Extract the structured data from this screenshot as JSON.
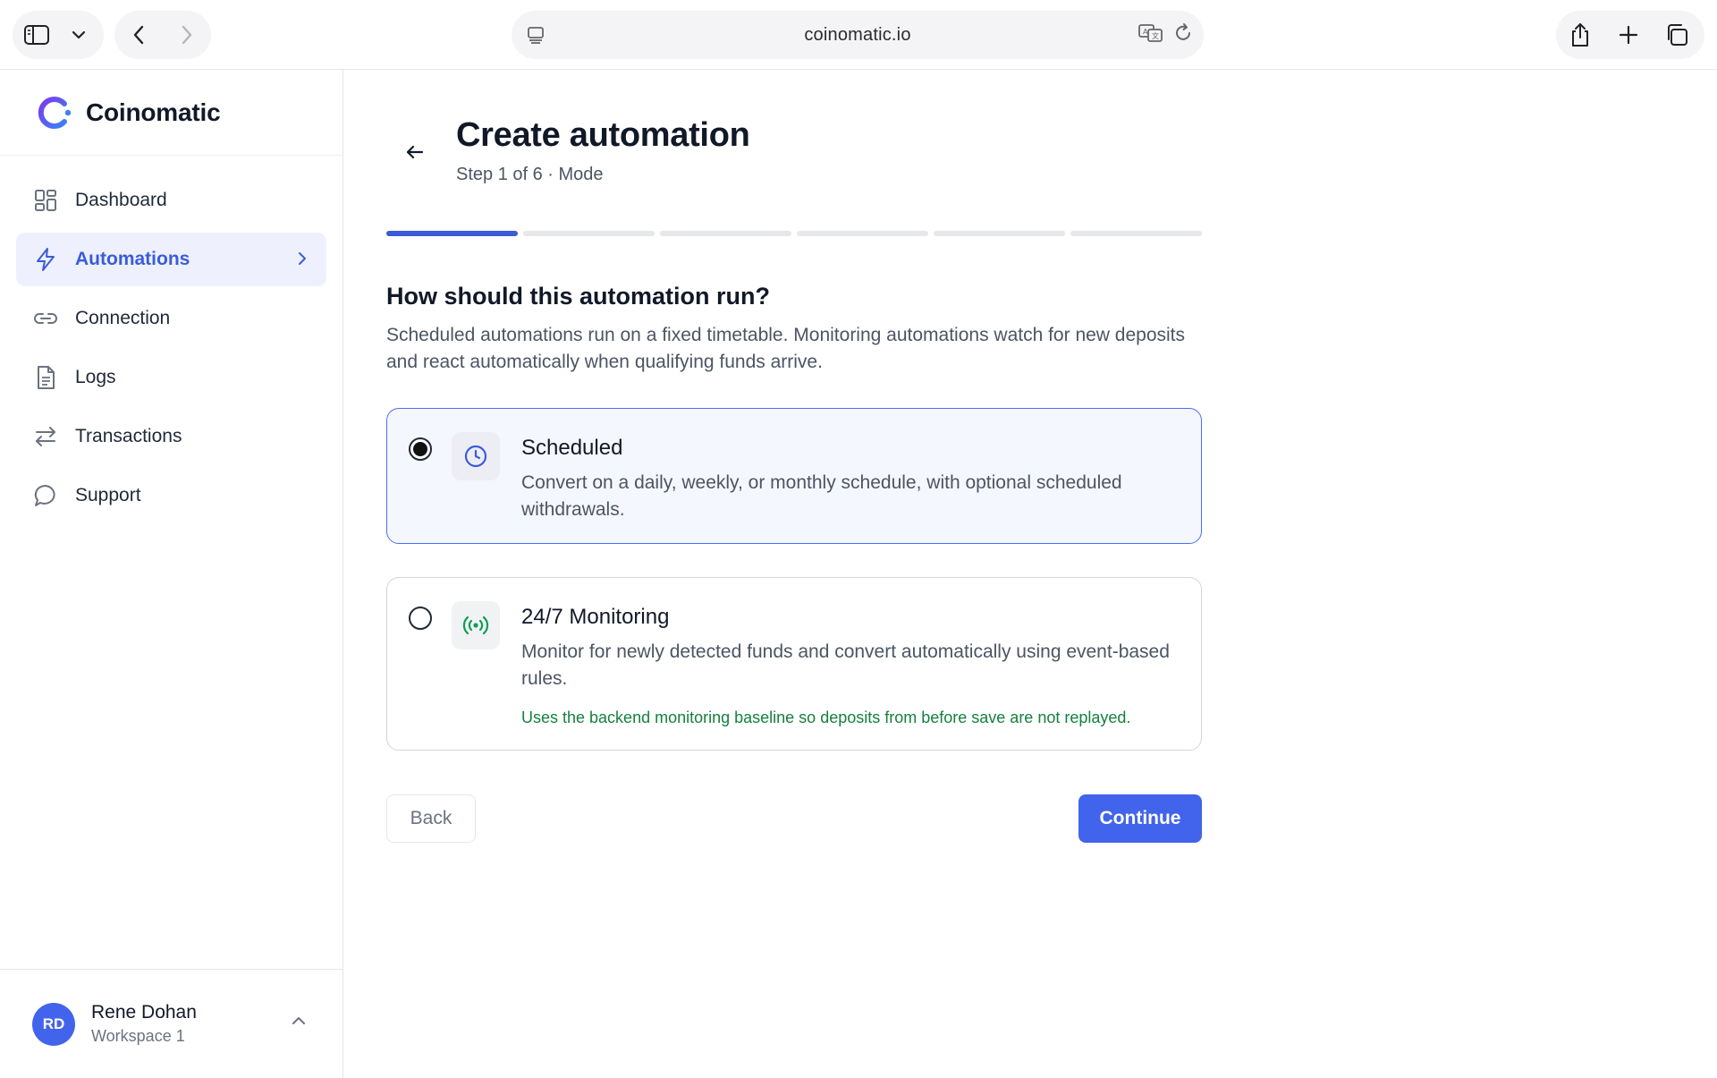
{
  "browser": {
    "url": "coinomatic.io"
  },
  "sidebar": {
    "brand": "Coinomatic",
    "items": [
      {
        "label": "Dashboard",
        "icon": "dashboard-icon"
      },
      {
        "label": "Automations",
        "icon": "bolt-icon",
        "active": true
      },
      {
        "label": "Connection",
        "icon": "link-icon"
      },
      {
        "label": "Logs",
        "icon": "document-icon"
      },
      {
        "label": "Transactions",
        "icon": "swap-icon"
      },
      {
        "label": "Support",
        "icon": "chat-icon"
      }
    ],
    "user": {
      "initials": "RD",
      "name": "Rene Dohan",
      "workspace": "Workspace 1"
    }
  },
  "main": {
    "title": "Create automation",
    "subtitle": "Step 1 of 6 · Mode",
    "progress": {
      "current_step": 1,
      "total_steps": 6
    },
    "question": "How should this automation run?",
    "description": "Scheduled automations run on a fixed timetable. Monitoring automations watch for new deposits and react automatically when qualifying funds arrive.",
    "options": [
      {
        "title": "Scheduled",
        "description": "Convert on a daily, weekly, or monthly schedule, with optional scheduled withdrawals.",
        "selected": true,
        "icon": "clock-icon"
      },
      {
        "title": "24/7 Monitoring",
        "description": "Monitor for newly detected funds and convert automatically using event-based rules.",
        "note": "Uses the backend monitoring baseline so deposits from before save are not replayed.",
        "selected": false,
        "icon": "broadcast-icon"
      }
    ],
    "back_label": "Back",
    "continue_label": "Continue"
  },
  "colors": {
    "accent": "#4263eb",
    "active_nav_bg": "#eef1fd",
    "note_green": "#15803d",
    "monitor_icon": "#0f9d58"
  }
}
